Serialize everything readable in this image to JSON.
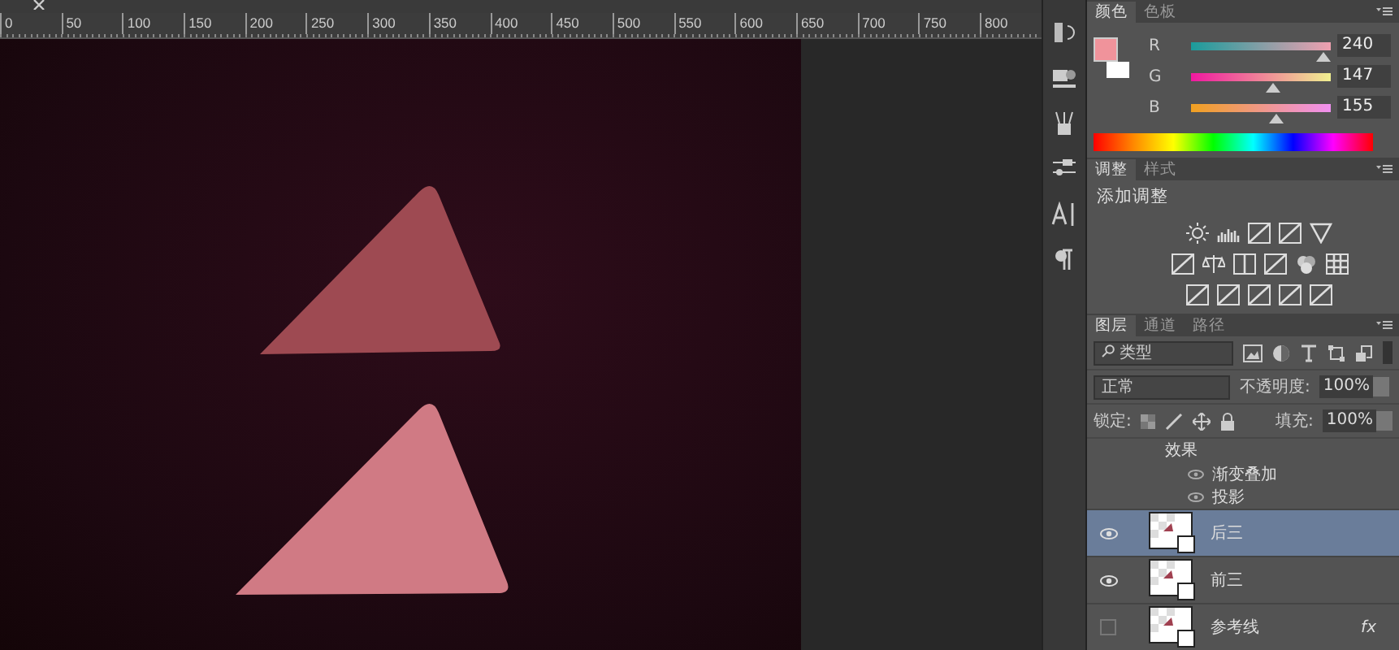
{
  "ruler": {
    "ticks": [
      "0",
      "50",
      "100",
      "150",
      "200",
      "250",
      "300",
      "350",
      "400",
      "450",
      "500",
      "550",
      "600",
      "650",
      "700",
      "750",
      "800"
    ]
  },
  "color_panel": {
    "tabs": [
      {
        "label": "颜色",
        "selected": true
      },
      {
        "label": "色板",
        "selected": false
      }
    ],
    "channels": [
      {
        "name": "R",
        "level": 0.94,
        "value": "240"
      },
      {
        "name": "G",
        "level": 0.58,
        "value": "147"
      },
      {
        "name": "B",
        "level": 0.61,
        "value": "155"
      }
    ]
  },
  "adjust_panel": {
    "tabs": [
      {
        "label": "调整",
        "selected": true
      },
      {
        "label": "样式",
        "selected": false
      }
    ],
    "title": "添加调整"
  },
  "layers_panel": {
    "tabs": [
      {
        "label": "图层",
        "selected": true
      },
      {
        "label": "通道",
        "selected": false
      },
      {
        "label": "路径",
        "selected": false
      }
    ],
    "filter": "类型",
    "blend_mode": "正常",
    "opacity_label": "不透明度:",
    "opacity": "100%",
    "lock_label": "锁定:",
    "fill_label": "填充:",
    "fill": "100%",
    "layers": [
      {
        "kind": "heading",
        "name": "效果"
      },
      {
        "kind": "effect",
        "name": "渐变叠加",
        "visible": true
      },
      {
        "kind": "effect",
        "name": "投影",
        "visible": true
      },
      {
        "kind": "layer",
        "name": "后三",
        "selected": true,
        "visible": true
      },
      {
        "kind": "layer",
        "name": "前三",
        "selected": false,
        "visible": true
      },
      {
        "kind": "layer",
        "name": "参考线",
        "selected": false,
        "visible": false,
        "badge": "fx"
      }
    ]
  }
}
